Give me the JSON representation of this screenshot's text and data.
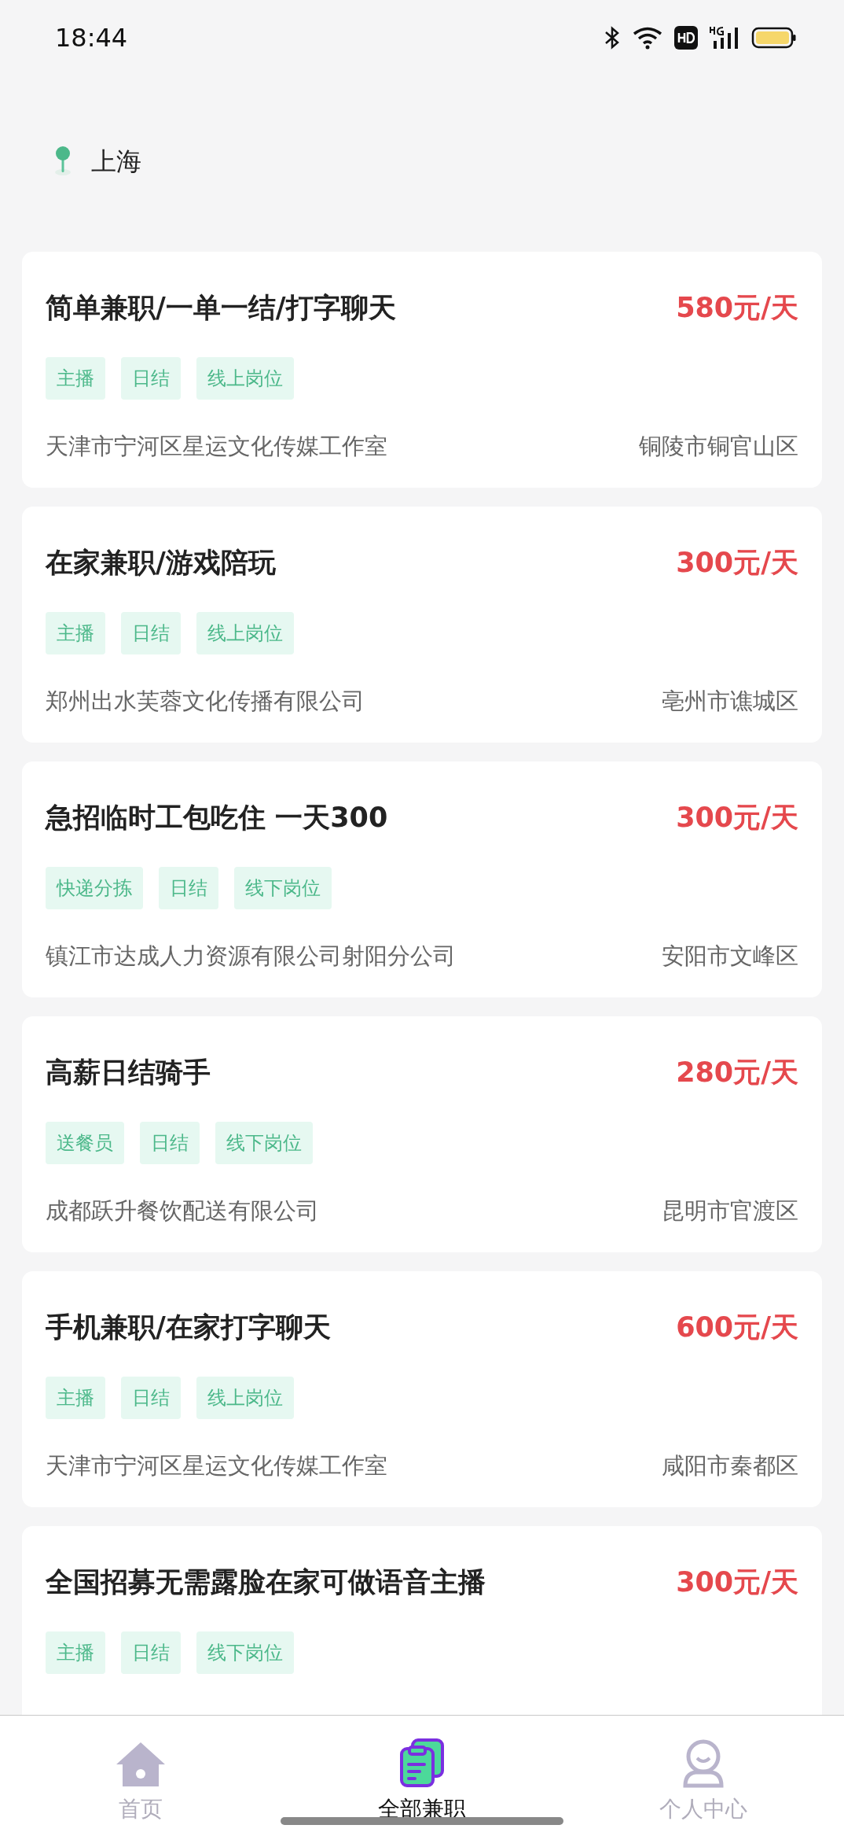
{
  "status_bar": {
    "time": "18:44"
  },
  "location": {
    "city": "上海"
  },
  "jobs": [
    {
      "title": "简单兼职/一单一结/打字聊天",
      "pay": "580元/天",
      "tags": [
        "主播",
        "日结",
        "线上岗位"
      ],
      "company": "天津市宁河区星运文化传媒工作室",
      "area": "铜陵市铜官山区"
    },
    {
      "title": "在家兼职/游戏陪玩",
      "pay": "300元/天",
      "tags": [
        "主播",
        "日结",
        "线上岗位"
      ],
      "company": "郑州出水芙蓉文化传播有限公司",
      "area": "亳州市谯城区"
    },
    {
      "title": "急招临时工包吃住 一天300",
      "pay": "300元/天",
      "tags": [
        "快递分拣",
        "日结",
        "线下岗位"
      ],
      "company": "镇江市达成人力资源有限公司射阳分公司",
      "area": "安阳市文峰区"
    },
    {
      "title": "高薪日结骑手",
      "pay": "280元/天",
      "tags": [
        "送餐员",
        "日结",
        "线下岗位"
      ],
      "company": "成都跃升餐饮配送有限公司",
      "area": "昆明市官渡区"
    },
    {
      "title": "手机兼职/在家打字聊天",
      "pay": "600元/天",
      "tags": [
        "主播",
        "日结",
        "线上岗位"
      ],
      "company": "天津市宁河区星运文化传媒工作室",
      "area": "咸阳市秦都区"
    },
    {
      "title": "全国招募无需露脸在家可做语音主播",
      "pay": "300元/天",
      "tags": [
        "主播",
        "日结",
        "线下岗位"
      ]
    }
  ],
  "bottom_nav": [
    {
      "kind": "home",
      "label": "首页",
      "selected": false
    },
    {
      "kind": "jobs",
      "label": "全部兼职",
      "selected": true
    },
    {
      "kind": "profile",
      "label": "个人中心",
      "selected": false
    }
  ]
}
